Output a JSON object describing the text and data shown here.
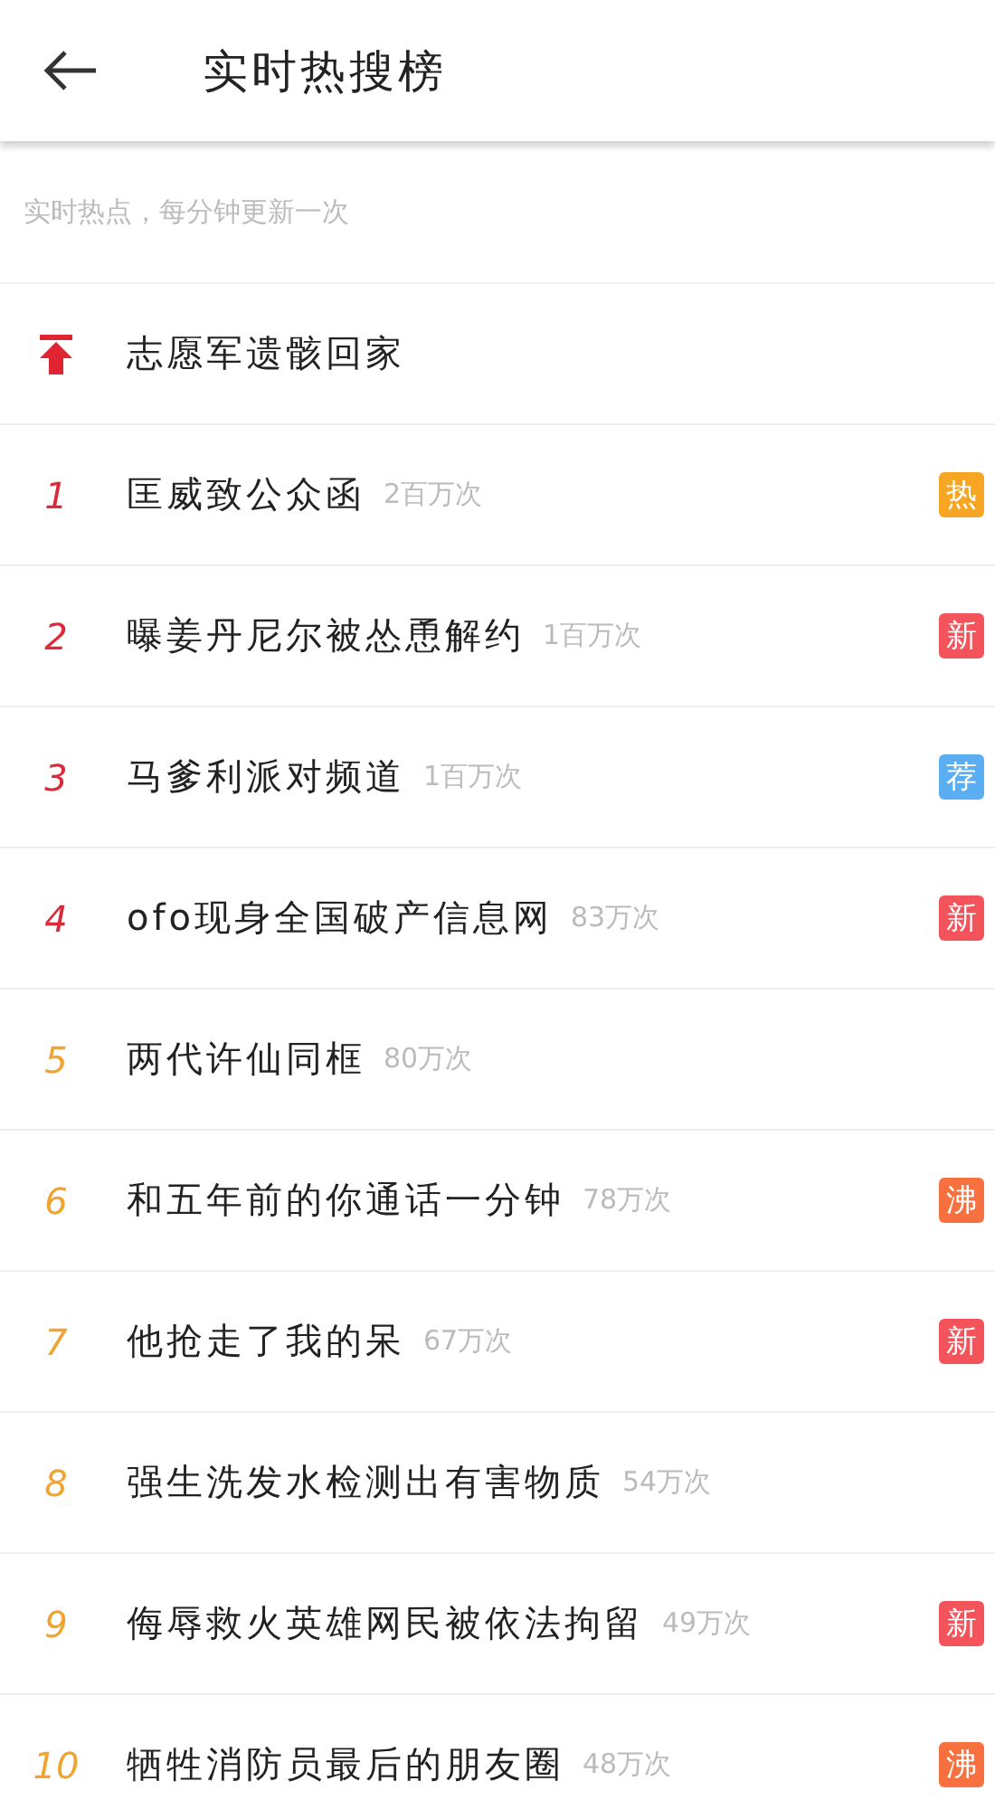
{
  "header": {
    "title": "实时热搜榜"
  },
  "subtitle": "实时热点，每分钟更新一次",
  "items": [
    {
      "kind": "pinned",
      "title": "志愿军遗骸回家"
    },
    {
      "kind": "ranked",
      "rank": "1",
      "color": "#d92b3a",
      "title": "匡威致公众函",
      "count": "2百万次",
      "badge": {
        "text": "热",
        "color": "#f6a623"
      }
    },
    {
      "kind": "ranked",
      "rank": "2",
      "color": "#d92b3a",
      "title": "曝姜丹尼尔被怂恿解约",
      "count": "1百万次",
      "badge": {
        "text": "新",
        "color": "#f3545c"
      }
    },
    {
      "kind": "ranked",
      "rank": "3",
      "color": "#d92b3a",
      "title": "马爹利派对频道",
      "count": "1百万次",
      "badge": {
        "text": "荐",
        "color": "#5caef2"
      }
    },
    {
      "kind": "ranked",
      "rank": "4",
      "color": "#d92b3a",
      "title": "ofo现身全国破产信息网",
      "count": "83万次",
      "badge": {
        "text": "新",
        "color": "#f3545c"
      }
    },
    {
      "kind": "ranked",
      "rank": "5",
      "color": "#f0a431",
      "title": "两代许仙同框",
      "count": "80万次"
    },
    {
      "kind": "ranked",
      "rank": "6",
      "color": "#f0a431",
      "title": "和五年前的你通话一分钟",
      "count": "78万次",
      "badge": {
        "text": "沸",
        "color": "#f7703f"
      }
    },
    {
      "kind": "ranked",
      "rank": "7",
      "color": "#f0a431",
      "title": "他抢走了我的呆",
      "count": "67万次",
      "badge": {
        "text": "新",
        "color": "#f3545c"
      }
    },
    {
      "kind": "ranked",
      "rank": "8",
      "color": "#f0a431",
      "title": "强生洗发水检测出有害物质",
      "count": "54万次"
    },
    {
      "kind": "ranked",
      "rank": "9",
      "color": "#f0a431",
      "title": "侮辱救火英雄网民被依法拘留",
      "count": "49万次",
      "badge": {
        "text": "新",
        "color": "#f3545c"
      }
    },
    {
      "kind": "ranked",
      "rank": "10",
      "color": "#f0a431",
      "title": "牺牲消防员最后的朋友圈",
      "count": "48万次",
      "badge": {
        "text": "沸",
        "color": "#f7703f"
      }
    }
  ]
}
